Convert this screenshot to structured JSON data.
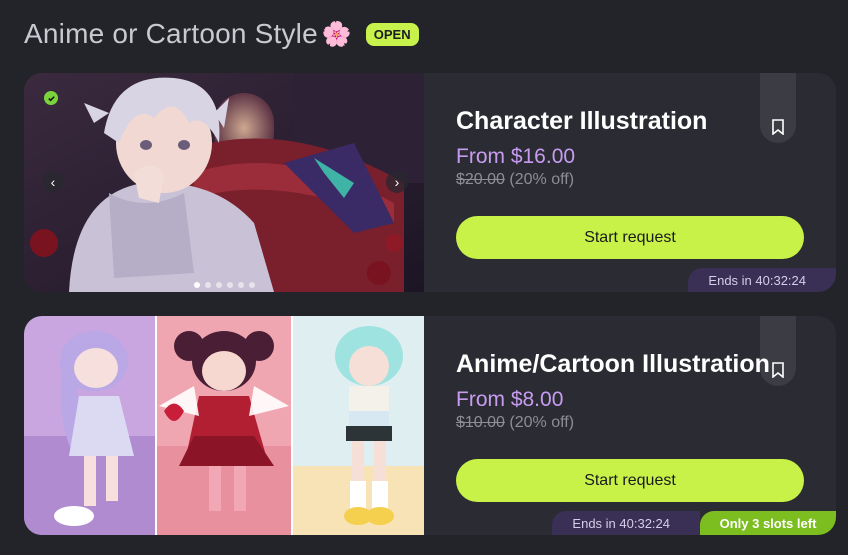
{
  "header": {
    "title": "Anime or Cartoon Style",
    "emoji": "🌸",
    "status_badge": "OPEN"
  },
  "cards": [
    {
      "title": "Character Illustration",
      "price": "From $16.00",
      "old_price": "$20.00",
      "discount": "(20% off)",
      "button_label": "Start request",
      "ends_label": "Ends in 40:32:24",
      "image_icon": "illustration-preview-image",
      "carousel_dots": 6,
      "carousel_active": 0,
      "verified": true
    },
    {
      "title": "Anime/Cartoon Illustration",
      "price": "From $8.00",
      "old_price": "$10.00",
      "discount": "(20% off)",
      "button_label": "Start request",
      "ends_label": "Ends in 40:32:24",
      "slots_label": "Only 3 slots left",
      "image_icon": "chibi-preview-image"
    }
  ],
  "colors": {
    "accent_green": "#c8f248",
    "price_purple": "#c79cf0",
    "background": "#23242a",
    "card": "#2b2c33"
  }
}
